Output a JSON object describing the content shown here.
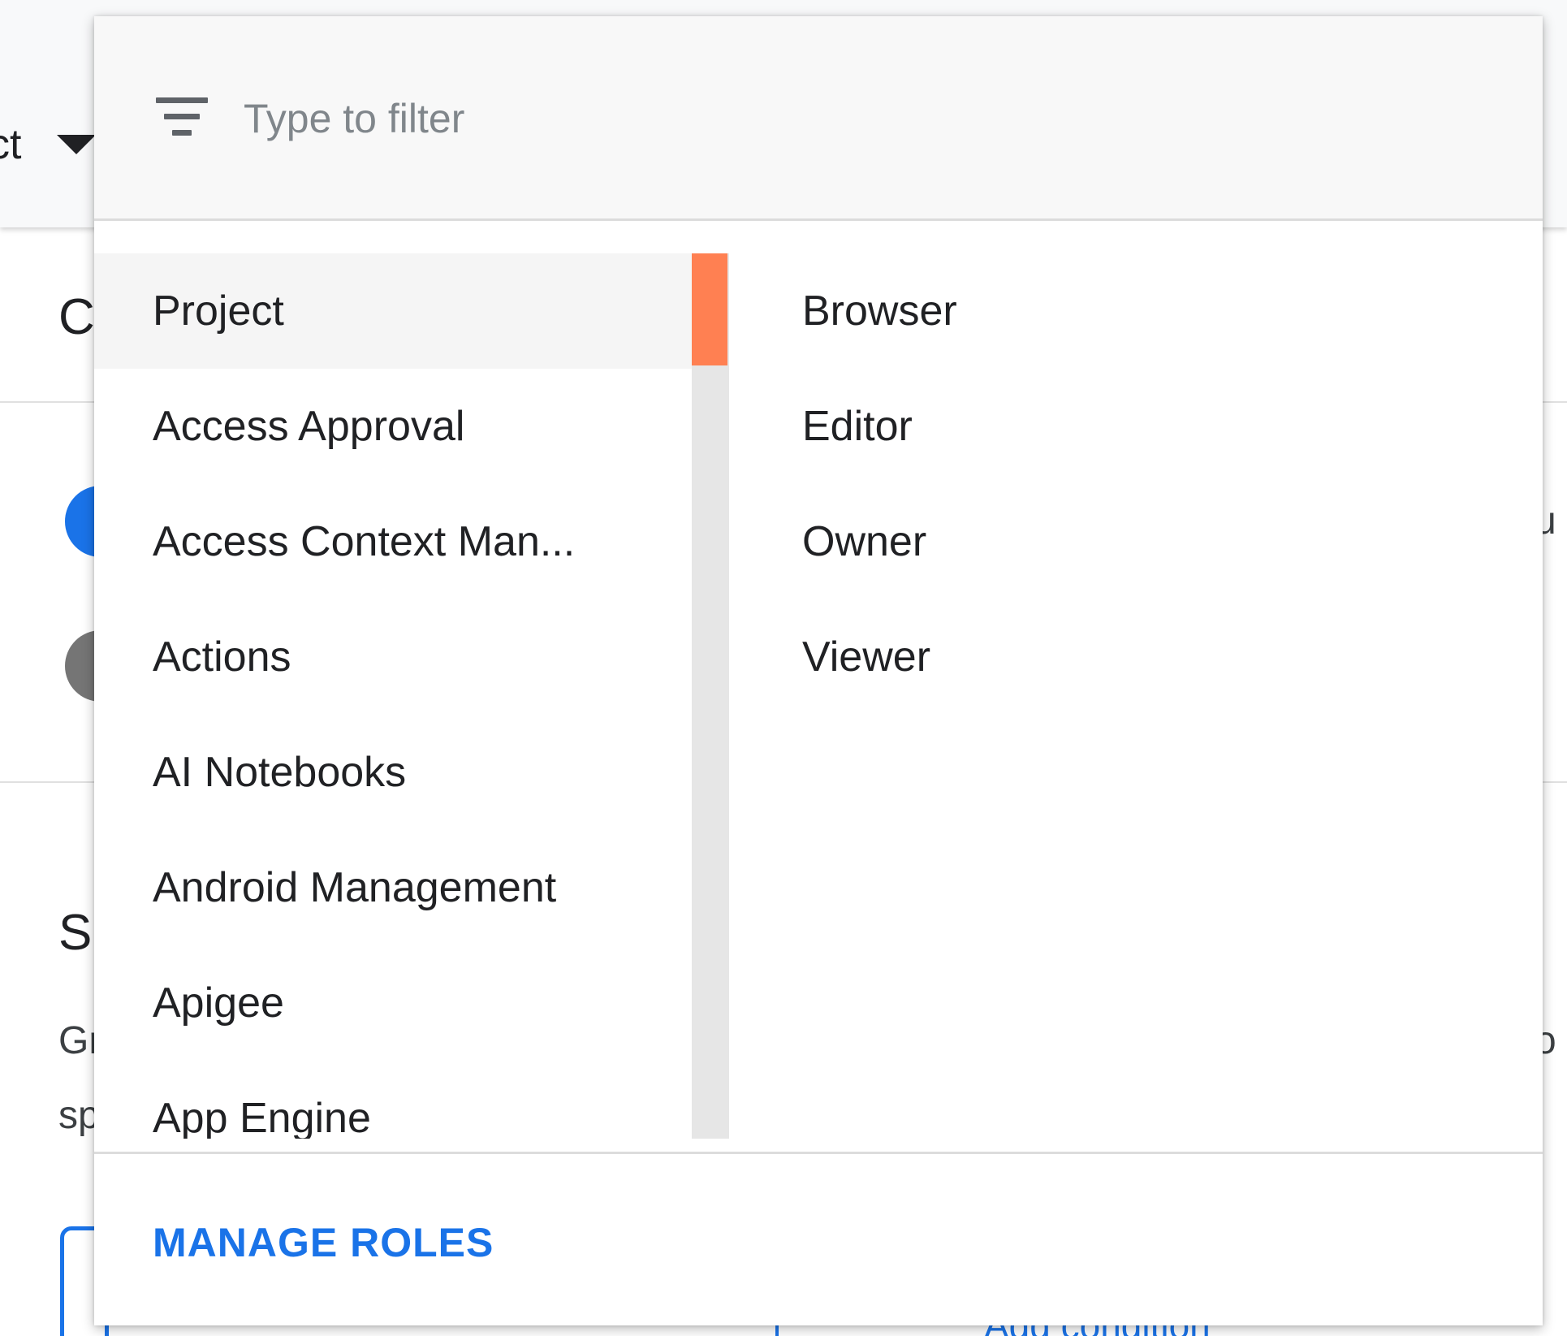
{
  "background": {
    "project_selector_fragment": "ct",
    "heading_fragment_1": "C",
    "heading_fragment_2": "S",
    "paragraph_fragment_1": "Gr",
    "paragraph_fragment_2": "sp",
    "right_fragment_1": "u",
    "right_fragment_2": "o",
    "add_condition_label": "Add condition"
  },
  "filter": {
    "icon": "filter-list-icon",
    "placeholder": "Type to filter",
    "value": ""
  },
  "services": [
    {
      "label": "Project",
      "selected": true
    },
    {
      "label": "Access Approval",
      "selected": false
    },
    {
      "label": "Access Context Man...",
      "selected": false
    },
    {
      "label": "Actions",
      "selected": false
    },
    {
      "label": "AI Notebooks",
      "selected": false
    },
    {
      "label": "Android Management",
      "selected": false
    },
    {
      "label": "Apigee",
      "selected": false
    },
    {
      "label": "App Engine",
      "selected": false
    }
  ],
  "roles": [
    {
      "label": "Browser"
    },
    {
      "label": "Editor"
    },
    {
      "label": "Owner"
    },
    {
      "label": "Viewer"
    }
  ],
  "footer": {
    "manage_roles_label": "MANAGE ROLES"
  },
  "colors": {
    "accent_blue": "#1a73e8",
    "scrollbar_thumb": "#ff8052",
    "selected_row": "#f5f5f5"
  }
}
